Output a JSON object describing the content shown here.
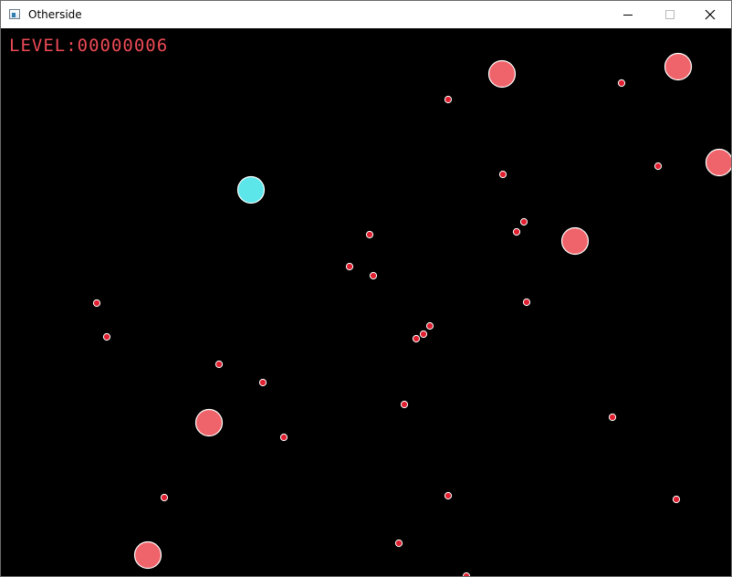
{
  "window": {
    "title": "Otherside",
    "app_icon": "window-app-icon",
    "controls": {
      "minimize_icon": "minimize-icon",
      "maximize_icon": "maximize-icon",
      "close_icon": "close-icon"
    }
  },
  "hud": {
    "level_label": "LEVEL:",
    "level_value": "00000006"
  },
  "colors": {
    "background": "#000000",
    "hud_text": "#ee4a56",
    "player": "#5ce6ea",
    "large_orb": "#ef646a",
    "small_dot": "#e02030",
    "orb_outline": "#ffffff"
  },
  "scene": {
    "player_count": 1,
    "large_orb_count": 6,
    "small_dot_count": 27
  }
}
